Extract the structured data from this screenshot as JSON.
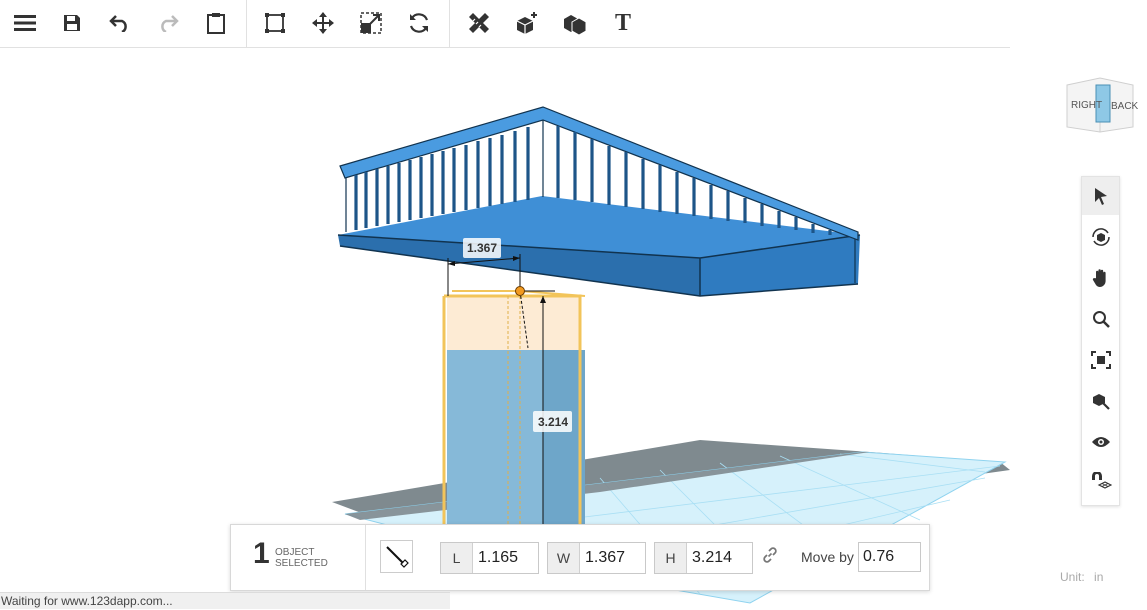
{
  "toolbar": {
    "items": [
      {
        "name": "menu-icon"
      },
      {
        "name": "save-icon"
      },
      {
        "name": "undo-icon"
      },
      {
        "name": "redo-icon"
      },
      {
        "name": "paste-icon"
      },
      {
        "name": "bounding-box-icon"
      },
      {
        "name": "move-icon"
      },
      {
        "name": "scale-icon"
      },
      {
        "name": "rotate-icon"
      },
      {
        "name": "measure-icon"
      },
      {
        "name": "add-primitive-icon"
      },
      {
        "name": "group-icon"
      },
      {
        "name": "text-icon"
      }
    ],
    "text_tool_label": "T"
  },
  "viewcube": {
    "right_label": "RIGHT",
    "back_label": "BACK"
  },
  "side_tools": [
    {
      "name": "select-icon",
      "active": true
    },
    {
      "name": "orbit-icon"
    },
    {
      "name": "pan-icon"
    },
    {
      "name": "zoom-icon"
    },
    {
      "name": "fit-view-icon"
    },
    {
      "name": "zoom-selected-icon"
    },
    {
      "name": "visibility-icon"
    },
    {
      "name": "snap-magnet-icon"
    }
  ],
  "scene": {
    "dim_width_label": "1.367",
    "dim_height_label": "3.214",
    "colors": {
      "bridge": "#3f8fd6",
      "bridge_dark": "#2b6fad",
      "pillar": "#86b9d8",
      "selection": "#f2c45a",
      "grid": "#a9dff4",
      "shadow": "#7f8a8f"
    }
  },
  "bottom_bar": {
    "selected_count": "1",
    "selected_label_line1": "OBJECT",
    "selected_label_line2": "SELECTED",
    "length_label": "L",
    "length_value": "1.165",
    "width_label": "W",
    "width_value": "1.367",
    "height_label": "H",
    "height_value": "3.214",
    "move_by_label": "Move by",
    "move_by_value": "0.76"
  },
  "units": {
    "label": "Unit:",
    "value": "in"
  },
  "status_bar": {
    "text": "Waiting for www.123dapp.com..."
  }
}
